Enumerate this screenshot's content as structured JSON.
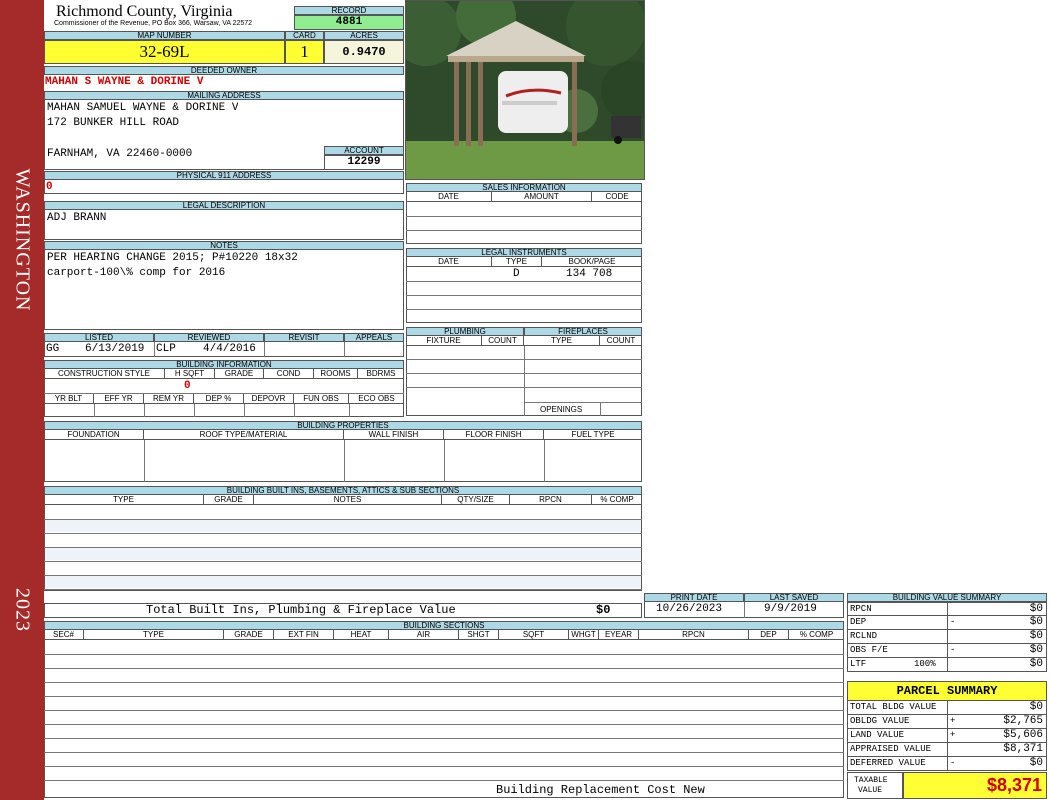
{
  "side": {
    "district": "WASHINGTON",
    "year": "2023"
  },
  "header": {
    "county": "Richmond County, Virginia",
    "commissioner": "Commissioner of the Revenue, PO Box 366, Warsaw, VA 22572"
  },
  "record": {
    "label": "RECORD",
    "value": "4881"
  },
  "map": {
    "label": "MAP NUMBER",
    "value": "32-69L"
  },
  "card": {
    "label": "CARD",
    "value": "1"
  },
  "acres": {
    "label": "ACRES",
    "value": "0.9470"
  },
  "owner": {
    "label": "DEEDED OWNER",
    "value": "MAHAN S WAYNE & DORINE V"
  },
  "mailing": {
    "label": "MAILING ADDRESS",
    "line1": "MAHAN SAMUEL WAYNE & DORINE V",
    "line2": "172 BUNKER HILL ROAD",
    "line3": "FARNHAM, VA 22460-0000"
  },
  "account": {
    "label": "ACCOUNT",
    "value": "12299"
  },
  "physical": {
    "label": "PHYSICAL 911 ADDRESS",
    "value": "0"
  },
  "legal": {
    "label": "LEGAL DESCRIPTION",
    "value": "ADJ BRANN"
  },
  "notes": {
    "label": "NOTES",
    "line1": "PER HEARING CHANGE 2015; P#10220 18x32",
    "line2": "carport-100\\% comp for 2016"
  },
  "listing": {
    "listed_label": "LISTED",
    "listed_by": "GG",
    "listed_date": "6/13/2019",
    "reviewed_label": "REVIEWED",
    "reviewed_by": "CLP",
    "reviewed_date": "4/4/2016",
    "revisit_label": "REVISIT",
    "appeals_label": "APPEALS"
  },
  "building_info": {
    "label": "BUILDING INFORMATION",
    "cols": [
      "CONSTRUCTION STYLE",
      "H SQFT",
      "GRADE",
      "COND",
      "ROOMS",
      "BDRMS"
    ],
    "hsqft": "0",
    "cols2": [
      "YR BLT",
      "EFF YR",
      "REM YR",
      "DEP %",
      "DEPOVR",
      "FUN OBS",
      "ECO OBS"
    ]
  },
  "sales": {
    "label": "SALES INFORMATION",
    "cols": [
      "DATE",
      "AMOUNT",
      "CODE"
    ]
  },
  "instruments": {
    "label": "LEGAL INSTRUMENTS",
    "cols": [
      "DATE",
      "TYPE",
      "BOOK/PAGE"
    ],
    "row1_type": "D",
    "row1_book": "134 708"
  },
  "plumbing": {
    "label": "PLUMBING",
    "cols": [
      "FIXTURE",
      "COUNT"
    ]
  },
  "fireplaces": {
    "label": "FIREPLACES",
    "cols": [
      "TYPE",
      "COUNT"
    ],
    "openings": "OPENINGS"
  },
  "properties": {
    "label": "BUILDING PROPERTIES",
    "cols": [
      "FOUNDATION",
      "ROOF TYPE/MATERIAL",
      "WALL FINISH",
      "FLOOR FINISH",
      "FUEL TYPE"
    ]
  },
  "builtins": {
    "label": "BUILDING BUILT INS, BASEMENTS, ATTICS & SUB SECTIONS",
    "cols": [
      "TYPE",
      "GRADE",
      "NOTES",
      "QTY/SIZE",
      "RPCN",
      "% COMP"
    ],
    "total_label": "Total Built Ins, Plumbing & Fireplace Value",
    "total_value": "$0"
  },
  "print": {
    "print_label": "PRINT DATE",
    "print_date": "10/26/2023",
    "saved_label": "LAST SAVED",
    "saved_date": "9/9/2019"
  },
  "sections": {
    "label": "BUILDING SECTIONS",
    "cols": [
      "SEC#",
      "TYPE",
      "GRADE",
      "EXT FIN",
      "HEAT",
      "AIR",
      "SHGT",
      "SQFT",
      "WHGT",
      "EYEAR",
      "RPCN",
      "DEP",
      "% COMP"
    ],
    "footer": "Building Replacement Cost New"
  },
  "bvs": {
    "label": "BUILDING VALUE SUMMARY",
    "rows": [
      {
        "name": "RPCN",
        "sign": "",
        "value": "$0"
      },
      {
        "name": "DEP",
        "sign": "-",
        "value": "$0"
      },
      {
        "name": "RCLND",
        "sign": "",
        "value": "$0"
      },
      {
        "name": "OBS F/E",
        "sign": "-",
        "value": "$0"
      },
      {
        "name": "LTF",
        "sign": "100%",
        "value": "$0"
      }
    ]
  },
  "parcel": {
    "label": "PARCEL SUMMARY",
    "rows": [
      {
        "name": "TOTAL BLDG VALUE",
        "sign": "",
        "value": "$0"
      },
      {
        "name": "OBLDG VALUE",
        "sign": "+",
        "value": "$2,765"
      },
      {
        "name": "LAND VALUE",
        "sign": "+",
        "value": "$5,606"
      },
      {
        "name": "APPRAISED VALUE",
        "sign": "",
        "value": "$8,371"
      },
      {
        "name": "DEFERRED VALUE",
        "sign": "-",
        "value": "$0"
      }
    ],
    "taxable_label1": "TAXABLE",
    "taxable_label2": "VALUE",
    "taxable_value": "$8,371"
  }
}
